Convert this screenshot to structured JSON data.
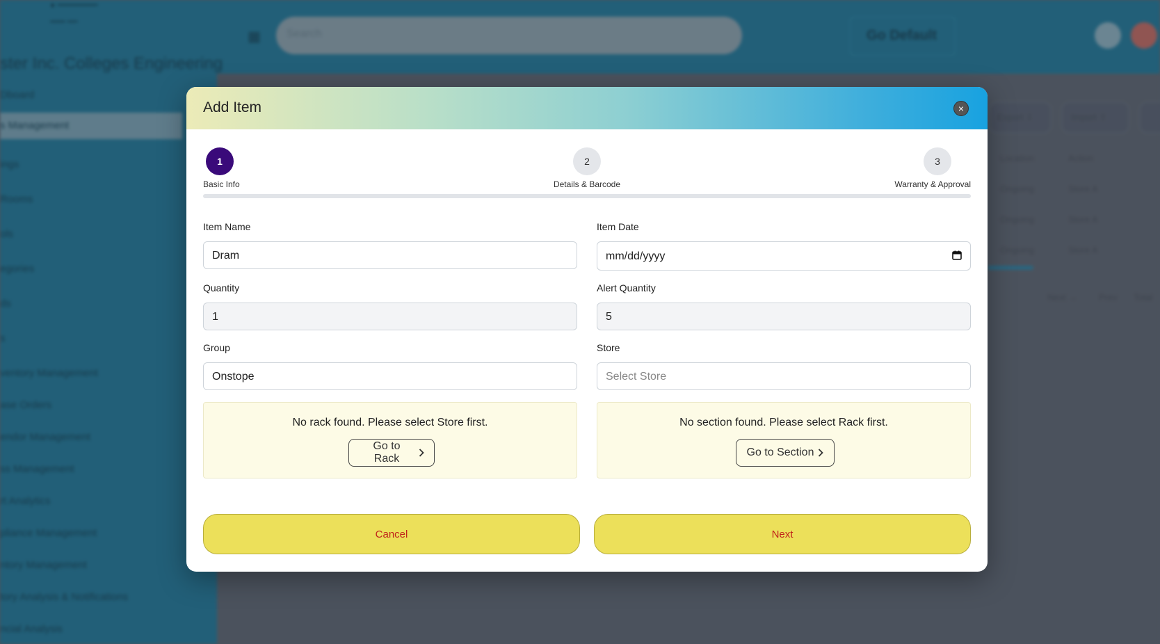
{
  "background": {
    "logo_line1": "● ━━━━━━━━",
    "logo_line2": "━━━ ━━",
    "search_placeholder": "Search",
    "default_button": "Go Default",
    "organization": "ster Inc. Colleges Engineering",
    "nav_items": [
      "Dboard",
      "s Management",
      "ings",
      "Rooms",
      "ols",
      "egories",
      "ds",
      "s",
      "ventory Management",
      "ase Orders",
      "endor Management",
      "ss Management",
      "rt Analytics",
      "pliance Management",
      "ntory Management",
      "tory Analysis & Notifications",
      "ncial Analysis"
    ],
    "chips": [
      "Export ⇩",
      "Import ⇧"
    ],
    "table_cells": [
      "Location",
      "Action",
      "Ongoing",
      "Store A"
    ],
    "pagination": [
      "Next →",
      "Prev",
      "Total"
    ]
  },
  "modal": {
    "title": "Add Item",
    "close_symbol": "×",
    "steps": [
      {
        "number": "1",
        "label": "Basic Info",
        "active": true
      },
      {
        "number": "2",
        "label": "Details & Barcode",
        "active": false
      },
      {
        "number": "3",
        "label": "Warranty & Approval",
        "active": false
      }
    ],
    "fields": {
      "item_name": {
        "label": "Item Name",
        "value": "Dram"
      },
      "item_date": {
        "label": "Item Date",
        "value": "mm/dd/yyyy"
      },
      "quantity": {
        "label": "Quantity",
        "value": "1"
      },
      "alert_quantity": {
        "label": "Alert Quantity",
        "value": "5"
      },
      "group": {
        "label": "Group",
        "value": "Onstope"
      },
      "store": {
        "label": "Store",
        "placeholder": "Select Store",
        "value": ""
      }
    },
    "rack_notice": {
      "text": "No rack found. Please select Store first.",
      "button": "Go to Rack"
    },
    "section_notice": {
      "text": "No section found. Please select Rack first.",
      "button": "Go to Section"
    },
    "buttons": {
      "cancel": "Cancel",
      "next": "Next"
    }
  },
  "colors": {
    "active_step": "#3a0a7a",
    "footer_button_bg": "#ece05a",
    "footer_button_text": "#c0221a",
    "notice_bg": "#fdfbe6"
  }
}
